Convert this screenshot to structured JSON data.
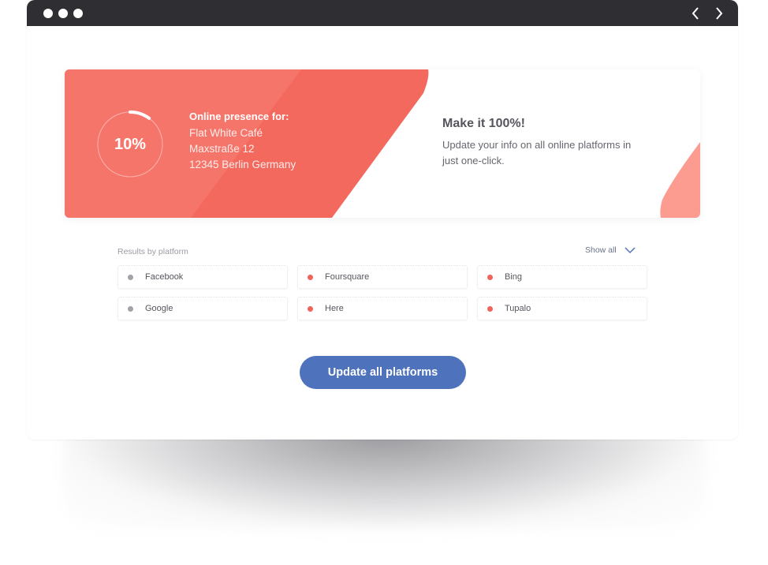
{
  "window": {
    "controls": [
      "dot-icon",
      "dot-icon",
      "dot-icon"
    ],
    "nav": {
      "back_icon": "chevron-left-icon",
      "forward_icon": "chevron-right-icon"
    }
  },
  "colors": {
    "coral": "#f4695e",
    "coral_light": "#f6796f",
    "coral_accent": "#fc9c90",
    "titlebar": "#2f2e33",
    "button_blue": "#4e73bc",
    "status_grey": "#a0a4a9",
    "status_red": "#f0645a"
  },
  "presence": {
    "percent": 10,
    "percent_label": "10%",
    "heading": "Online presence for:",
    "business_name": "Flat White Café",
    "street": "Maxstraße 12",
    "city": "12345 Berlin Germany"
  },
  "promo": {
    "title": "Make it 100%!",
    "description": "Update your info on all online platforms in just one-click."
  },
  "results": {
    "label": "Results by platform",
    "show_all": "Show all",
    "show_all_icon": "chevron-down-icon",
    "platforms": [
      {
        "name": "Facebook",
        "status": "grey"
      },
      {
        "name": "Foursquare",
        "status": "red"
      },
      {
        "name": "Bing",
        "status": "red"
      },
      {
        "name": "Google",
        "status": "grey"
      },
      {
        "name": "Here",
        "status": "red"
      },
      {
        "name": "Tupalo",
        "status": "red"
      }
    ]
  },
  "cta": {
    "label": "Update all platforms"
  }
}
